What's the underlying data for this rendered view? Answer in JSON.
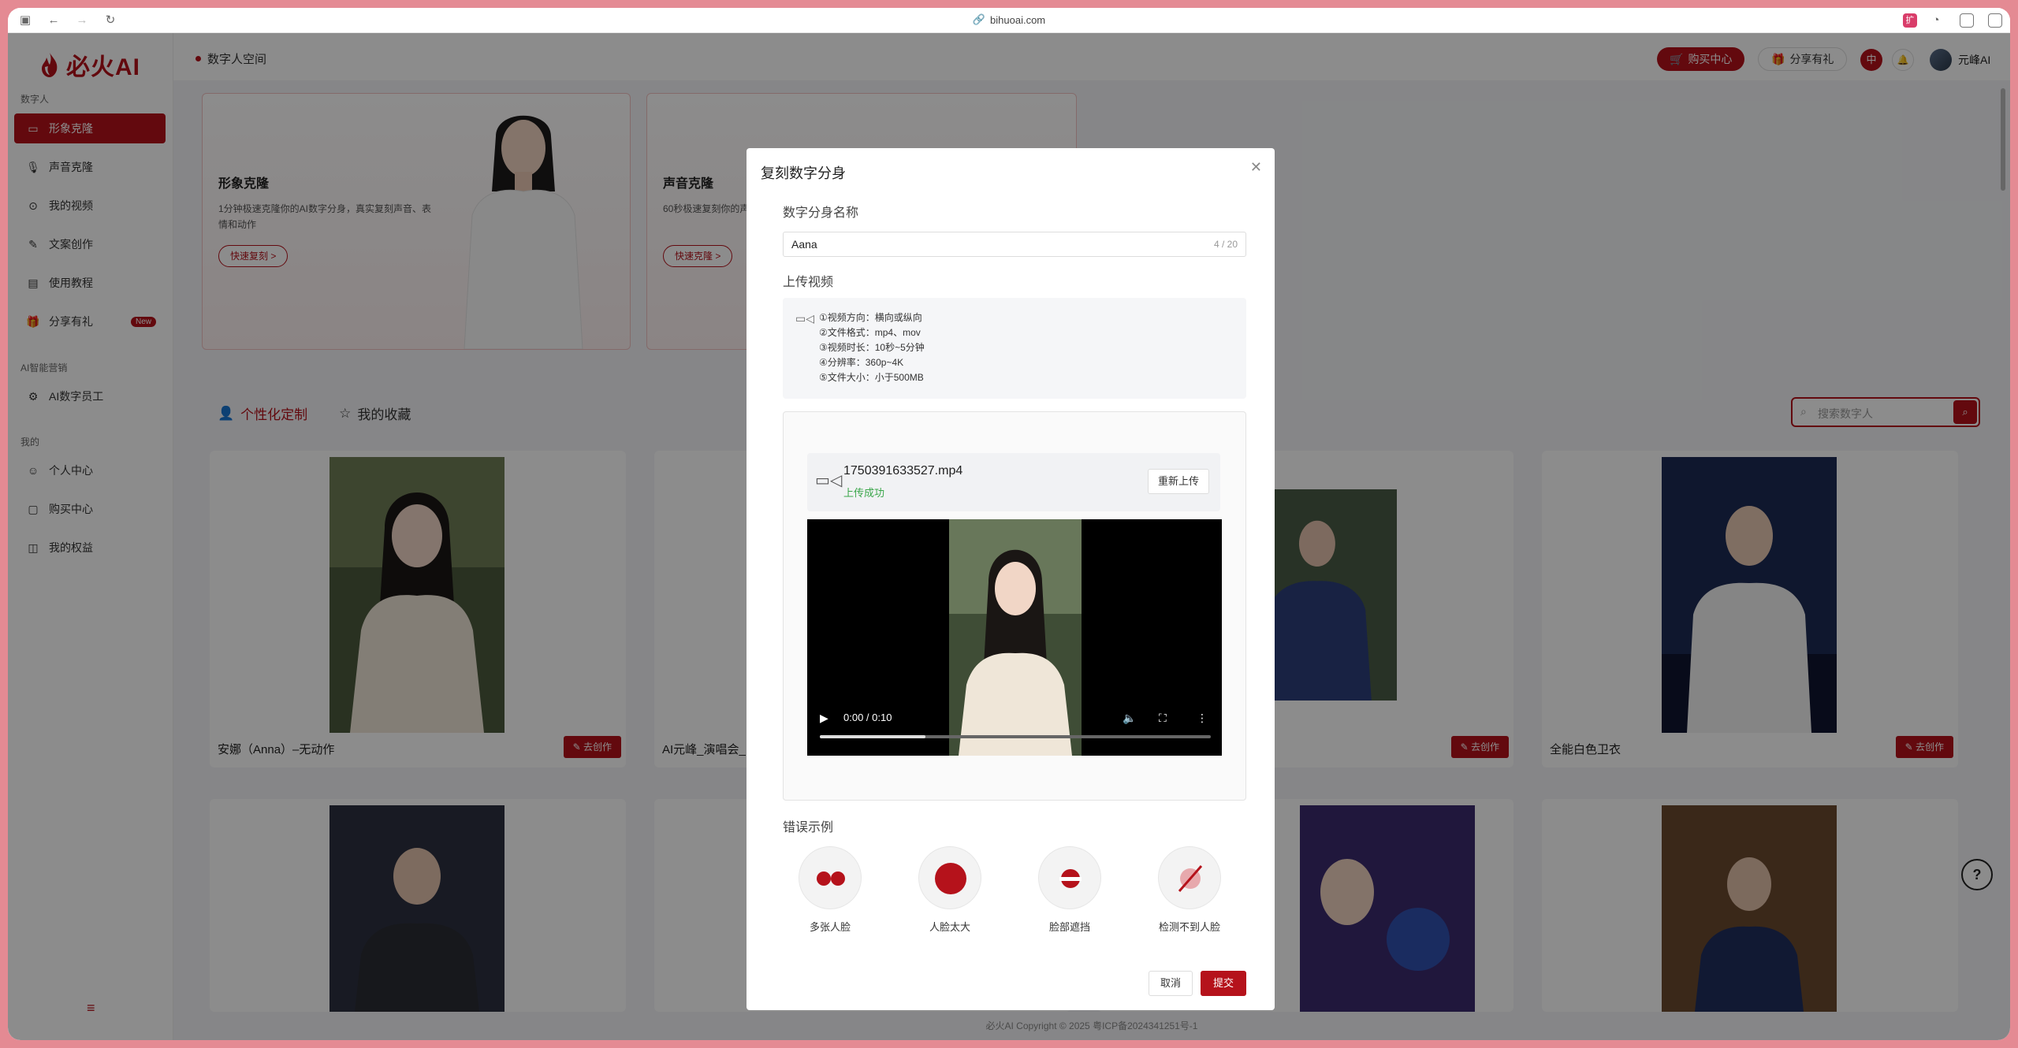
{
  "browser": {
    "url": "bihuoai.com"
  },
  "brand": {
    "name": "必火AI",
    "color": "#b5121b"
  },
  "sidebar": {
    "sections": [
      {
        "title": "数字人",
        "items": [
          {
            "label": "形象克隆",
            "icon": "video-icon",
            "active": true
          },
          {
            "label": "声音克隆",
            "icon": "mic-icon"
          },
          {
            "label": "我的视频",
            "icon": "play-circle-icon"
          },
          {
            "label": "文案创作",
            "icon": "pen-icon"
          },
          {
            "label": "使用教程",
            "icon": "doc-icon"
          },
          {
            "label": "分享有礼",
            "icon": "gift-icon",
            "badge": "New"
          }
        ]
      },
      {
        "title": "AI智能营销",
        "items": [
          {
            "label": "AI数字员工",
            "icon": "robot-icon"
          }
        ]
      },
      {
        "title": "我的",
        "items": [
          {
            "label": "个人中心",
            "icon": "user-icon"
          },
          {
            "label": "购买中心",
            "icon": "cart-icon"
          },
          {
            "label": "我的权益",
            "icon": "rights-icon"
          }
        ]
      }
    ]
  },
  "header": {
    "breadcrumb": "数字人空间",
    "buy_label": "购买中心",
    "share_label": "分享有礼",
    "lang": "中",
    "user_name": "元峰AI"
  },
  "features": [
    {
      "title": "形象克隆",
      "desc": "1分钟极速克隆你的AI数字分身，真实复刻声音、表情和动作",
      "button": "快速复刻 >"
    },
    {
      "title": "声音克隆",
      "desc": "60秒极速复刻你的声",
      "button": "快速克隆 >"
    }
  ],
  "tabs": [
    {
      "label": "个性化定制",
      "active": true
    },
    {
      "label": "我的收藏",
      "active": false
    }
  ],
  "search": {
    "placeholder": "搜索数字人"
  },
  "cards": [
    {
      "name": "安娜（Anna）–无动作",
      "button": "去创作"
    },
    {
      "name": "AI元峰_演唱会_",
      "button": ""
    },
    {
      "name": "",
      "button": "去创作"
    },
    {
      "name": "全能白色卫衣",
      "button": "去创作"
    }
  ],
  "footer": "必火AI   Copyright © 2025 粤ICP备2024341251号-1",
  "modal": {
    "title": "复刻数字分身",
    "name_label": "数字分身名称",
    "name_value": "Aana",
    "name_count": "4 / 20",
    "upload_label": "上传视频",
    "requirements": [
      "①视频方向：横向或纵向",
      "②文件格式：mp4、mov",
      "③视频时长：10秒~5分钟",
      "④分辨率：360p~4K",
      "⑤文件大小：小于500MB"
    ],
    "file_name": "1750391633527.mp4",
    "file_status": "上传成功",
    "reupload_label": "重新上传",
    "player_time": "0:00 / 0:10",
    "player_progress": 0.27,
    "error_label": "错误示例",
    "errors": [
      "多张人脸",
      "人脸太大",
      "脸部遮挡",
      "检测不到人脸"
    ],
    "cancel_label": "取消",
    "submit_label": "提交"
  }
}
